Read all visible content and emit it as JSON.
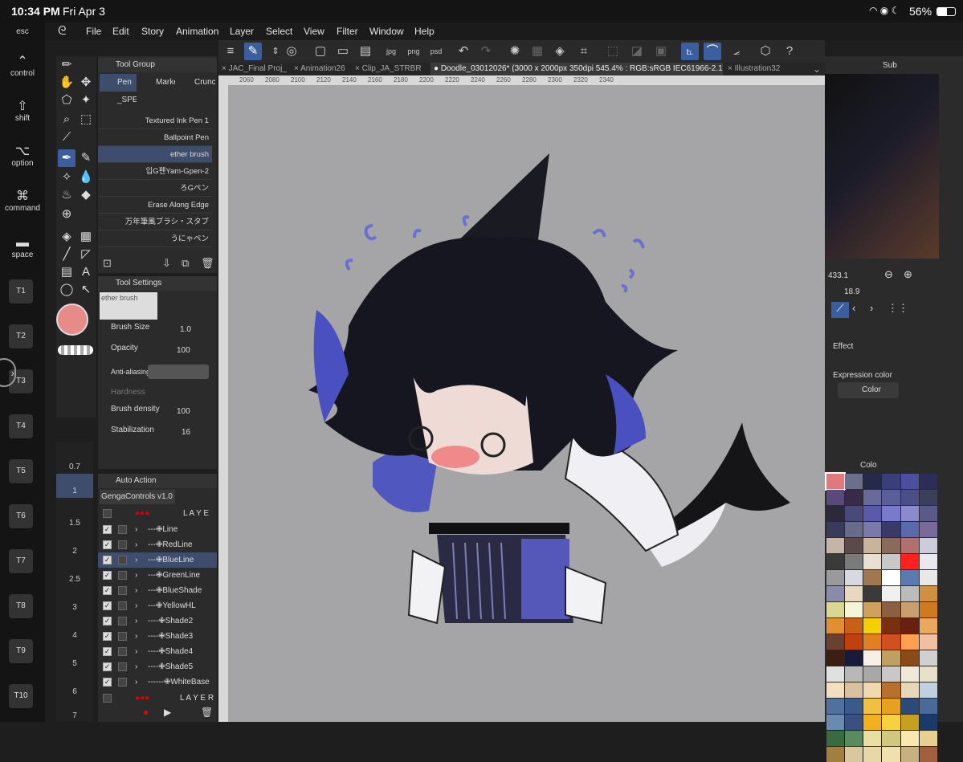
{
  "status": {
    "time": "10:34 PM",
    "date": "Fri Apr 3",
    "battery": "56%"
  },
  "menu": [
    "File",
    "Edit",
    "Story",
    "Animation",
    "Layer",
    "Select",
    "View",
    "Filter",
    "Window",
    "Help"
  ],
  "keys": [
    {
      "glyph": "",
      "label": "esc"
    },
    {
      "glyph": "⌃",
      "label": "control"
    },
    {
      "glyph": "⇧",
      "label": "shift"
    },
    {
      "glyph": "⌥",
      "label": "option"
    },
    {
      "glyph": "⌘",
      "label": "command"
    },
    {
      "glyph": "▬",
      "label": "space"
    }
  ],
  "tkeys": [
    "T1",
    "T2",
    "T3",
    "T4",
    "T5",
    "T6",
    "T7",
    "T8",
    "T9",
    "T10"
  ],
  "tabs": [
    "JAC_Final Proj_",
    "Animation26",
    "Clip_JA_STRBR",
    "Doodle_03012026* (3000 x 2000px 350dpi 545.4% : RGB:sRGB IEC61966-2.1)",
    "Illustration32"
  ],
  "ruler": [
    "2060",
    "2080",
    "2100",
    "2120",
    "2140",
    "2160",
    "2180",
    "2200",
    "2220",
    "2240",
    "2260",
    "2280",
    "2300",
    "2320",
    "2340"
  ],
  "toolgroup": {
    "title": "Tool Group",
    "tabs": [
      "Pen",
      "Marke",
      "Crunc"
    ],
    "subtab": "_SPE",
    "brushes": [
      "Textured Ink Pen 1",
      "Ballpoint Pen",
      "ether brush",
      "입G펜Yam-Gpen-2",
      "ろGペン",
      "Erase Along Edge",
      "万年筆風ブラシ・スタブ",
      "うにゃペン"
    ]
  },
  "toolsettings": {
    "title": "Tool Settings",
    "preview": "ether brush",
    "brush_size_label": "Brush Size",
    "brush_size": "1.0",
    "opacity_label": "Opacity",
    "opacity": "100",
    "aa_label": "Anti-aliasing",
    "hardness_label": "Hardness",
    "density_label": "Brush density",
    "density": "100",
    "stab_label": "Stabilization",
    "stab": "16"
  },
  "sizes": [
    "0.7",
    "1",
    "1.5",
    "2",
    "2.5",
    "3",
    "4",
    "5",
    "6",
    "7"
  ],
  "autoaction": {
    "title": "Auto Action",
    "set": "GengaControls v1.0",
    "group1": "L A Y E",
    "group2": "L A Y E R",
    "items": [
      "---✙Line",
      "---✙RedLine",
      "---✙BlueLine",
      "---✙GreenLine",
      "---✙BlueShade",
      "---✙YellowHL",
      "----✙Shade2",
      "----✙Shade3",
      "----✙Shade4",
      "----✙Shade5",
      "------✙WhiteBase"
    ]
  },
  "subview": {
    "tab": "Sub",
    "zoom": "433.1",
    "angle": "18.9"
  },
  "effect": {
    "title": "Effect",
    "expr_label": "Expression color",
    "expr_value": "Color"
  },
  "colorset": {
    "tab": "Colo"
  },
  "swatch_colors": [
    "#e07a7a",
    "#6a6f8c",
    "#252a4a",
    "#3a3f7a",
    "#4c4fa0",
    "#2d2d5a",
    "#5a4a7a",
    "#3a2a4a",
    "#6a6a9a",
    "#5a5f9a",
    "#4a4f8a",
    "#3a3f5a",
    "#2a2a3a",
    "#4a4a7a",
    "#5a5aaa",
    "#7a7acc",
    "#8a8acc",
    "#5a5a8a",
    "#3a3a5a",
    "#6a6a8a",
    "#7a7aaa",
    "#3a3a6a",
    "#5a6aaa",
    "#7a6a9a",
    "#c4b6a6",
    "#5a4a4a",
    "#c8b49a",
    "#8a6a5a",
    "#b07070",
    "#ccccdd",
    "#3a3a3a",
    "#7a7a7a",
    "#e8e0d0",
    "#c8c8c8",
    "#ff2020",
    "#e8e8f0",
    "#9a9a9a",
    "#d8d8e0",
    "#a07850",
    "#ffffff",
    "#5a7ab0",
    "#e8e8e8",
    "#8a8aaa",
    "#e8d8c0",
    "#3a3a3a",
    "#f0f0f0",
    "#bbbbbb",
    "#d09040",
    "#d8d890",
    "#f5f5dc",
    "#d0a060",
    "#8a6040",
    "#c8a070",
    "#d07a20",
    "#e09030",
    "#c86018",
    "#f4d000",
    "#7a3010",
    "#6a2010",
    "#e8a860",
    "#6a4030",
    "#c04010",
    "#e08020",
    "#d05020",
    "#ffa050",
    "#f0c0a0",
    "#3a2010",
    "#1a1a3a",
    "#f8f0e8",
    "#c0a060",
    "#8a4a1a",
    "#d0d0d0",
    "#e0e0e0",
    "#b8b8b8",
    "#a8a8a8",
    "#c8c8c8",
    "#f0e8d8",
    "#e8e0c8",
    "#f0e0c0",
    "#d8c0a0",
    "#f0d8b0",
    "#b87030",
    "#e8d8b8",
    "#c0d0e0",
    "#5070a0",
    "#3a5a8a",
    "#f0c040",
    "#e8a020",
    "#2a4a7a",
    "#4a6a9a",
    "#6a8ab0",
    "#3a5080",
    "#f0b020",
    "#f8d040",
    "#c8a020",
    "#1a3a6a",
    "#3a6a40",
    "#5a8a60",
    "#e8e0a0",
    "#d0c880",
    "#f8e8b0",
    "#e8d090",
    "#a08040",
    "#d8c8a0",
    "#e8d8a8",
    "#f0e0b0",
    "#c8b080",
    "#a06040"
  ]
}
